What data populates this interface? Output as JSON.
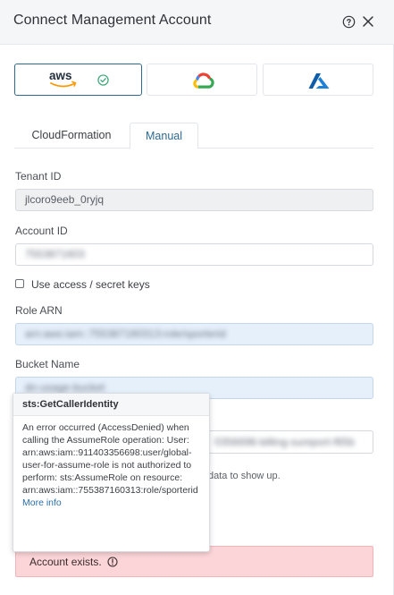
{
  "header": {
    "title": "Connect Management Account"
  },
  "providers": {
    "aws_label": "aws",
    "items": [
      {
        "name": "aws",
        "selected": true
      },
      {
        "name": "google-cloud",
        "selected": false
      },
      {
        "name": "azure",
        "selected": false
      }
    ]
  },
  "tabs": {
    "cloudformation": "CloudFormation",
    "manual": "Manual",
    "active": "Manual"
  },
  "form": {
    "tenant_id_label": "Tenant ID",
    "tenant_id_value": "jlcoro9eeb_0ryjq",
    "account_id_label": "Account ID",
    "account_id_value": "7553871603",
    "use_keys_label": "Use access / secret keys",
    "use_keys_checked": false,
    "role_arn_label": "Role ARN",
    "role_arn_value": "arn:aws:iam::755387160313:role/sporterid",
    "bucket_label": "Bucket Name",
    "bucket_value": "dn-usage-bucket",
    "partial_field_value": "0356698-billing-sureport-f65b",
    "partial_help_text": "data to show up."
  },
  "tooltip": {
    "title": "sts:GetCallerIdentity",
    "body": "An error occurred (AccessDenied) when calling the AssumeRole operation: User: arn:aws:iam::911403356698:user/global-user-for-assume-role is not authorized to perform: sts:AssumeRole on resource: arn:aws:iam::755387160313:role/sporterid",
    "link": "More info"
  },
  "alert": {
    "text": "Account exists.",
    "color": "#fbd5d8"
  },
  "colors": {
    "accent": "#2d6a8f",
    "success": "#3aa676",
    "aws_orange": "#ff9900"
  }
}
